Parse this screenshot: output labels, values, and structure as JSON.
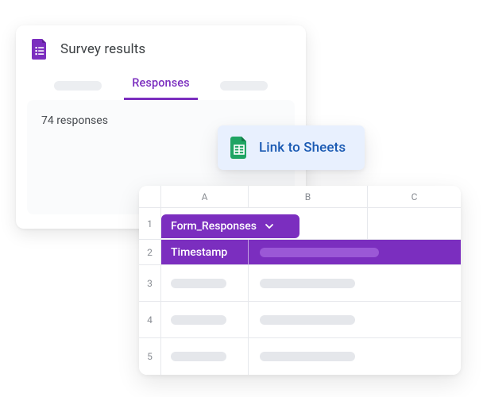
{
  "forms": {
    "title": "Survey results",
    "tabs": {
      "active": "Responses"
    },
    "responses_count_text": "74 responses"
  },
  "link_button": {
    "label": "Link to Sheets"
  },
  "spreadsheet": {
    "columns": {
      "A": "A",
      "B": "B",
      "C": "C"
    },
    "rows": {
      "r1": "1",
      "r2": "2",
      "r3": "3",
      "r4": "4",
      "r5": "5"
    },
    "sheet_tab_label": "Form_Responses",
    "header_col_a": "Timestamp"
  },
  "colors": {
    "forms_purple": "#7b2ebf",
    "sheets_green": "#1fa463",
    "link_bg": "#e8f0fe",
    "link_text": "#1a5ab3"
  }
}
